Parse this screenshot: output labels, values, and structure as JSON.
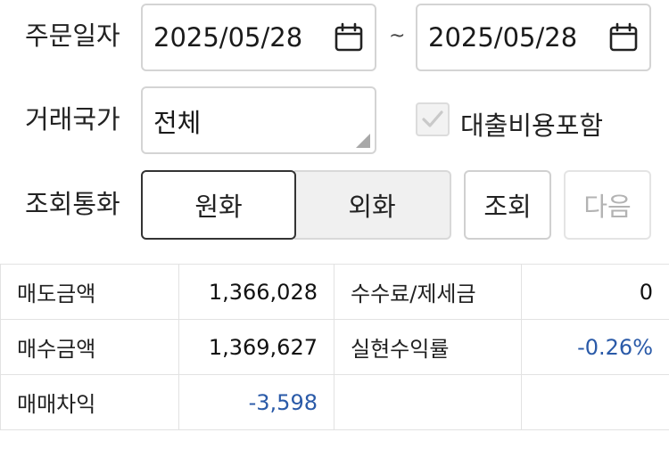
{
  "order_date": {
    "label": "주문일자",
    "start": "2025/05/28",
    "separator": "~",
    "end": "2025/05/28"
  },
  "country": {
    "label": "거래국가",
    "value": "전체"
  },
  "include_loan_fee": {
    "label": "대출비용포함",
    "checked": true
  },
  "currency": {
    "label": "조회통화",
    "options": [
      "원화",
      "외화"
    ],
    "selected": "원화"
  },
  "buttons": {
    "search": "조회",
    "next": "다음"
  },
  "summary": {
    "sell_amount": {
      "label": "매도금액",
      "value": "1,366,028"
    },
    "fee_tax": {
      "label": "수수료/제세금",
      "value": "0"
    },
    "buy_amount": {
      "label": "매수금액",
      "value": "1,369,627"
    },
    "realized_return": {
      "label": "실현수익률",
      "value": "-0.26%"
    },
    "trade_diff": {
      "label": "매매차익",
      "value": "-3,598"
    }
  },
  "colors": {
    "negative_value": "#2a5aa8",
    "active_border": "#333333",
    "disabled_text": "#b3b3b3"
  },
  "icons": [
    "calendar-icon",
    "calendar-icon",
    "check-icon",
    "resize-grip-icon"
  ]
}
